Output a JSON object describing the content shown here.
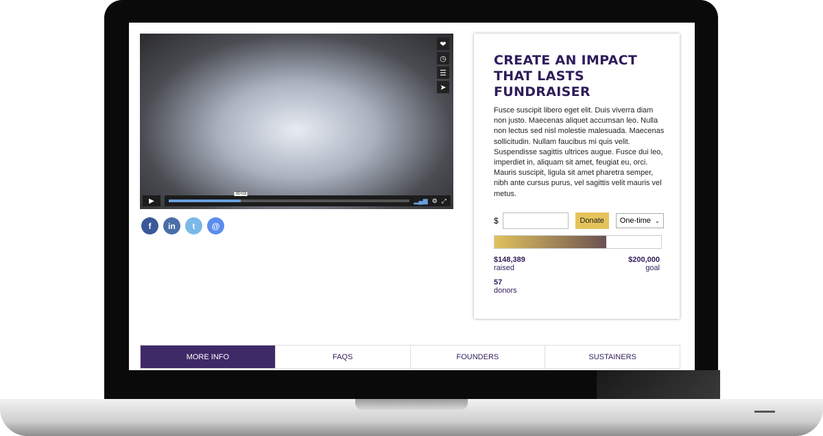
{
  "video": {
    "current_time": "00:03",
    "progress_percent": 30,
    "side_icons": [
      "heart-icon",
      "clock-icon",
      "layers-icon",
      "send-icon"
    ]
  },
  "social": [
    {
      "name": "facebook",
      "label": "f",
      "color": "#3b5998"
    },
    {
      "name": "linkedin",
      "label": "in",
      "color": "#4a6ea8"
    },
    {
      "name": "twitter",
      "label": "t",
      "color": "#7ab8e8"
    },
    {
      "name": "email",
      "label": "@",
      "color": "#5b8def"
    }
  ],
  "campaign": {
    "title": "CREATE AN IMPACT THAT LASTS FUNDRAISER",
    "description": "Fusce suscipit libero eget elit. Duis viverra diam non justo. Maecenas aliquet accumsan leo. Nulla non lectus sed nisl molestie malesuada. Maecenas sollicitudin. Nullam faucibus mi quis velit. Suspendisse sagittis ultrices augue. Fusce dui leo, imperdiet in, aliquam sit amet, feugiat eu, orci. Mauris suscipit, ligula sit amet pharetra semper, nibh ante cursus purus, vel sagittis velit mauris vel metus.",
    "currency": "$",
    "amount_value": "",
    "donate_label": "Donate",
    "frequency": "One-time",
    "progress_fill_percent": 67,
    "raised": "$148,389",
    "raised_label": "raised",
    "goal": "$200,000",
    "goal_label": "goal",
    "donors": "57",
    "donors_label": "donors"
  },
  "tabs": [
    {
      "label": "MORE INFO",
      "active": true
    },
    {
      "label": "FAQS"
    },
    {
      "label": "FOUNDERS"
    },
    {
      "label": "SUSTAINERS"
    }
  ],
  "colors": {
    "brand": "#2e1d5a",
    "accent": "#e5c35c",
    "tab_active": "#3f2a68"
  }
}
